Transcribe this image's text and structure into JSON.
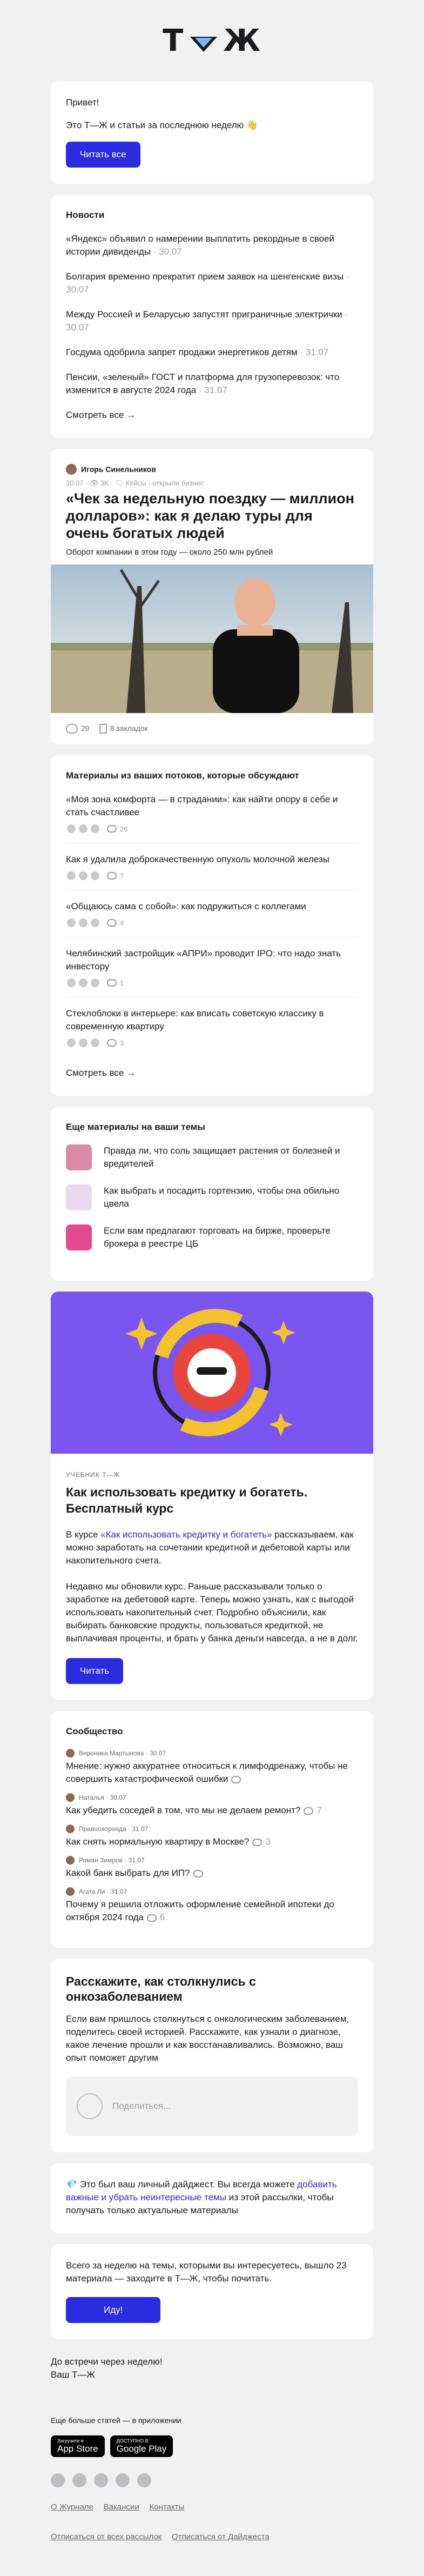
{
  "brand": {
    "logo_left": "Т",
    "logo_right": "Ж"
  },
  "greeting": {
    "hello": "Привет!",
    "intro": "Это Т—Ж и статьи за последнюю неделю",
    "wave": "👋",
    "button": "Читать все"
  },
  "news": {
    "title": "Новости",
    "items": [
      {
        "text": "«Яндекс» объявил о намерении выплатить рекордные в своей истории дивиденды",
        "date": "· 30.07"
      },
      {
        "text": "Болгария временно прекратит прием заявок на шенгенские визы",
        "date": "· 30.07"
      },
      {
        "text": "Между Россией и Беларусью запустят приграничные электрички",
        "date": "· 30.07"
      },
      {
        "text": "Госдума одобрила запрет продажи энергетиков детям",
        "date": "· 31.07"
      },
      {
        "text": "Пенсии, «зеленый» ГОСТ и платформа для грузоперевозок: что изменится в августе 2024 года",
        "date": "· 31.07"
      }
    ],
    "more": "Смотреть все →"
  },
  "article": {
    "author": "Игорь Синельников",
    "meta": "30.07 · 👁 3К · 🗨 Кейсы · открыли бизнес",
    "title": "«Чек за недельную поездку — миллион долларов»: как я делаю туры для очень богатых людей",
    "lead": "Оборот компании в этом году — около 250 млн рублей",
    "comments": "29",
    "bookmarks": "8 закладок"
  },
  "discussions": {
    "title": "Материалы из ваших потоков, которые обсуждают",
    "items": [
      {
        "text": "«Моя зона комфорта — в страдании»: как найти опору в себе и стать счастливее",
        "count": "26"
      },
      {
        "text": "Как я удалила доброкачественную опухоль молочной железы",
        "count": "7"
      },
      {
        "text": "«Общаюсь сама с собой»: как подружиться с коллегами",
        "count": "4"
      },
      {
        "text": "Челябинский застройщик «АПРИ» проводит IPO: что надо знать инвестору",
        "count": "1"
      },
      {
        "text": "Стеклоблоки в интерьере: как вписать советскую классику в современную квартиру",
        "count": "3"
      }
    ],
    "more": "Смотреть все →"
  },
  "more_materials": {
    "title": "Еще материалы на ваши темы",
    "items": [
      {
        "text": "Правда ли, что соль защищает растения от болезней и вредителей",
        "color": "#d98aa6"
      },
      {
        "text": "Как выбрать и посадить гортензию, чтобы она обильно цвела",
        "color": "#e8d9ef"
      },
      {
        "text": "Если вам предлагают торговать на бирже, проверьте брокера в реестре ЦБ",
        "color": "#e24b8f"
      }
    ]
  },
  "course": {
    "kicker": "УЧЕБНИК Т—Ж",
    "title": "Как использовать кредитку и богатеть. Бесплатный курс",
    "p1_pre": "В курсе ",
    "p1_link": "«Как использовать кредитку и богатеть»",
    "p1_post": " рассказываем, как можно заработать на сочетании кредитной и дебетовой карты или накопительного счета.",
    "p2": "Недавно мы обновили курс. Раньше рассказывали только о заработке на дебетовой карте. Теперь можно узнать, как с выгодой использовать накопительный счет. Подробно объяснили, как выбирать банковские продукты, пользоваться кредиткой, не выплачивая проценты, и брать у банка деньги навсегда, а не в долг.",
    "button": "Читать",
    "banner_color": "#7a55f0"
  },
  "community": {
    "title": "Сообщество",
    "items": [
      {
        "author": "Вероника Мартынова · 30.07",
        "text": "Мнение: нужно аккуратнее относиться к лимфодренажу, чтобы не совершить катастрофической ошибки",
        "count": ""
      },
      {
        "author": "Наталья · 30.07",
        "text": "Как убедить соседей в том, что мы не делаем ремонт?",
        "count": "7"
      },
      {
        "author": "Правоохоронда · 31.07",
        "text": "Как снять нормальную квартиру в Москве?",
        "count": "3"
      },
      {
        "author": "Роман Зимров · 31.07",
        "text": "Какой банк выбрать для ИП?",
        "count": ""
      },
      {
        "author": "Агата Ли · 31.07",
        "text": "Почему я решила отложить оформление семейной ипотеки до октября 2024 года",
        "count": "6"
      }
    ]
  },
  "story": {
    "title": "Расскажите, как столкнулись с онкозаболеванием",
    "text": "Если вам пришлось столкнуться с онкологическим заболеванием, поделитесь своей историей. Расскажите, как узнали о диагнозе, какое лечение прошли и как восстанавливались. Возможно, ваш опыт поможет другим",
    "share": "Поделиться..."
  },
  "digest": {
    "pre": "💎 Это был ваш личный дайджест. Вы всегда можете ",
    "link": "добавить важные и убрать неинтересные темы",
    "post": " из этой рассылки, чтобы получать только актуальные материалы"
  },
  "summary": {
    "text": "Всего за неделю на темы, которыми вы интересуетесь, вышло 23 материала — заходите в Т—Ж, чтобы почитать.",
    "button": "Иду!"
  },
  "signoff": {
    "line1": "До встречи через неделю!",
    "line2": "Ваш Т—Ж"
  },
  "footer": {
    "apps_title": "Еще больше статей — в приложении",
    "appstore_small": "Загрузите в",
    "appstore": "App Store",
    "gplay_small": "ДОСТУПНО В",
    "gplay": "Google Play",
    "links": [
      "О Журнале",
      "Вакансии",
      "Контакты"
    ],
    "unsub": [
      "Отписаться от всех рассылок",
      "Отписаться от Дайджеста"
    ]
  },
  "accent": "#2b2be0"
}
